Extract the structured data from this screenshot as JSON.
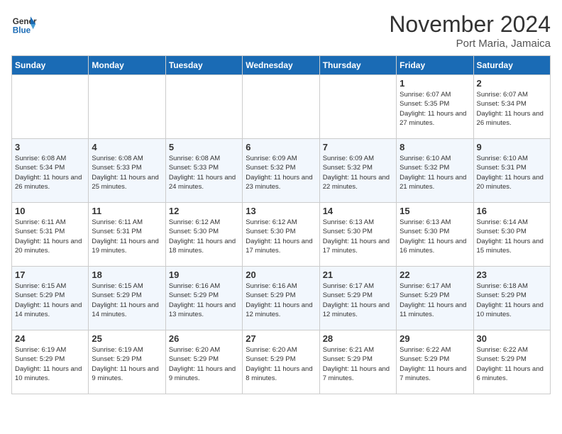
{
  "header": {
    "logo_line1": "General",
    "logo_line2": "Blue",
    "month": "November 2024",
    "location": "Port Maria, Jamaica"
  },
  "days_of_week": [
    "Sunday",
    "Monday",
    "Tuesday",
    "Wednesday",
    "Thursday",
    "Friday",
    "Saturday"
  ],
  "weeks": [
    [
      {
        "day": "",
        "info": ""
      },
      {
        "day": "",
        "info": ""
      },
      {
        "day": "",
        "info": ""
      },
      {
        "day": "",
        "info": ""
      },
      {
        "day": "",
        "info": ""
      },
      {
        "day": "1",
        "info": "Sunrise: 6:07 AM\nSunset: 5:35 PM\nDaylight: 11 hours and 27 minutes."
      },
      {
        "day": "2",
        "info": "Sunrise: 6:07 AM\nSunset: 5:34 PM\nDaylight: 11 hours and 26 minutes."
      }
    ],
    [
      {
        "day": "3",
        "info": "Sunrise: 6:08 AM\nSunset: 5:34 PM\nDaylight: 11 hours and 26 minutes."
      },
      {
        "day": "4",
        "info": "Sunrise: 6:08 AM\nSunset: 5:33 PM\nDaylight: 11 hours and 25 minutes."
      },
      {
        "day": "5",
        "info": "Sunrise: 6:08 AM\nSunset: 5:33 PM\nDaylight: 11 hours and 24 minutes."
      },
      {
        "day": "6",
        "info": "Sunrise: 6:09 AM\nSunset: 5:32 PM\nDaylight: 11 hours and 23 minutes."
      },
      {
        "day": "7",
        "info": "Sunrise: 6:09 AM\nSunset: 5:32 PM\nDaylight: 11 hours and 22 minutes."
      },
      {
        "day": "8",
        "info": "Sunrise: 6:10 AM\nSunset: 5:32 PM\nDaylight: 11 hours and 21 minutes."
      },
      {
        "day": "9",
        "info": "Sunrise: 6:10 AM\nSunset: 5:31 PM\nDaylight: 11 hours and 20 minutes."
      }
    ],
    [
      {
        "day": "10",
        "info": "Sunrise: 6:11 AM\nSunset: 5:31 PM\nDaylight: 11 hours and 20 minutes."
      },
      {
        "day": "11",
        "info": "Sunrise: 6:11 AM\nSunset: 5:31 PM\nDaylight: 11 hours and 19 minutes."
      },
      {
        "day": "12",
        "info": "Sunrise: 6:12 AM\nSunset: 5:30 PM\nDaylight: 11 hours and 18 minutes."
      },
      {
        "day": "13",
        "info": "Sunrise: 6:12 AM\nSunset: 5:30 PM\nDaylight: 11 hours and 17 minutes."
      },
      {
        "day": "14",
        "info": "Sunrise: 6:13 AM\nSunset: 5:30 PM\nDaylight: 11 hours and 17 minutes."
      },
      {
        "day": "15",
        "info": "Sunrise: 6:13 AM\nSunset: 5:30 PM\nDaylight: 11 hours and 16 minutes."
      },
      {
        "day": "16",
        "info": "Sunrise: 6:14 AM\nSunset: 5:30 PM\nDaylight: 11 hours and 15 minutes."
      }
    ],
    [
      {
        "day": "17",
        "info": "Sunrise: 6:15 AM\nSunset: 5:29 PM\nDaylight: 11 hours and 14 minutes."
      },
      {
        "day": "18",
        "info": "Sunrise: 6:15 AM\nSunset: 5:29 PM\nDaylight: 11 hours and 14 minutes."
      },
      {
        "day": "19",
        "info": "Sunrise: 6:16 AM\nSunset: 5:29 PM\nDaylight: 11 hours and 13 minutes."
      },
      {
        "day": "20",
        "info": "Sunrise: 6:16 AM\nSunset: 5:29 PM\nDaylight: 11 hours and 12 minutes."
      },
      {
        "day": "21",
        "info": "Sunrise: 6:17 AM\nSunset: 5:29 PM\nDaylight: 11 hours and 12 minutes."
      },
      {
        "day": "22",
        "info": "Sunrise: 6:17 AM\nSunset: 5:29 PM\nDaylight: 11 hours and 11 minutes."
      },
      {
        "day": "23",
        "info": "Sunrise: 6:18 AM\nSunset: 5:29 PM\nDaylight: 11 hours and 10 minutes."
      }
    ],
    [
      {
        "day": "24",
        "info": "Sunrise: 6:19 AM\nSunset: 5:29 PM\nDaylight: 11 hours and 10 minutes."
      },
      {
        "day": "25",
        "info": "Sunrise: 6:19 AM\nSunset: 5:29 PM\nDaylight: 11 hours and 9 minutes."
      },
      {
        "day": "26",
        "info": "Sunrise: 6:20 AM\nSunset: 5:29 PM\nDaylight: 11 hours and 9 minutes."
      },
      {
        "day": "27",
        "info": "Sunrise: 6:20 AM\nSunset: 5:29 PM\nDaylight: 11 hours and 8 minutes."
      },
      {
        "day": "28",
        "info": "Sunrise: 6:21 AM\nSunset: 5:29 PM\nDaylight: 11 hours and 7 minutes."
      },
      {
        "day": "29",
        "info": "Sunrise: 6:22 AM\nSunset: 5:29 PM\nDaylight: 11 hours and 7 minutes."
      },
      {
        "day": "30",
        "info": "Sunrise: 6:22 AM\nSunset: 5:29 PM\nDaylight: 11 hours and 6 minutes."
      }
    ]
  ]
}
